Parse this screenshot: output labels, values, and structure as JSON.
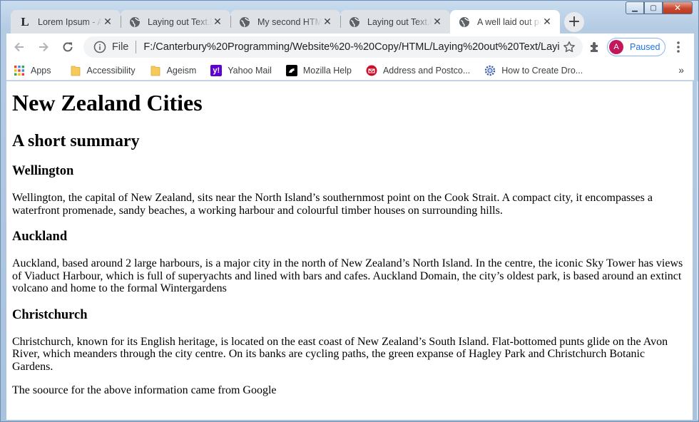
{
  "window": {
    "controls": {
      "minimize": "▁",
      "maximize": "▢",
      "close": "✕"
    }
  },
  "tabs": [
    {
      "title": "Lorem Ipsum - All the facts",
      "favicon": "L",
      "icon": "letter-l-icon",
      "active": false
    },
    {
      "title": "Laying out Text.html",
      "icon": "globe-icon",
      "active": false
    },
    {
      "title": "My second HTML page",
      "icon": "globe-icon",
      "active": false
    },
    {
      "title": "Laying out Text.html",
      "icon": "globe-icon",
      "active": false
    },
    {
      "title": "A well laid out page",
      "icon": "globe-icon",
      "active": true
    }
  ],
  "new_tab": "+",
  "toolbar": {
    "scheme": "File",
    "url": "F:/Canterbury%20Programming/Website%20-%20Copy/HTML/Laying%20out%20Text/Layin...",
    "profile_initial": "A",
    "profile_status": "Paused"
  },
  "bookmarks": [
    {
      "label": "Apps",
      "icon": "apps-grid-icon"
    },
    {
      "label": "Accessibility",
      "icon": "folder-icon"
    },
    {
      "label": "Ageism",
      "icon": "folder-icon"
    },
    {
      "label": "Yahoo Mail",
      "icon": "yahoo-icon"
    },
    {
      "label": "Mozilla Help",
      "icon": "mozilla-icon"
    },
    {
      "label": "Address and Postco...",
      "icon": "nz-post-icon"
    },
    {
      "label": "How to Create Dro...",
      "icon": "gear-icon"
    }
  ],
  "bookmarks_more": "»",
  "colors": {
    "accent": "#1a73e8",
    "avatar": "#c2185b",
    "folder": "#f6c95b"
  },
  "page": {
    "h1": "New Zealand Cities",
    "h2": "A short summary",
    "sections": [
      {
        "heading": "Wellington",
        "text": "Wellington, the capital of New Zealand, sits near the North Island’s southernmost point on the Cook Strait. A compact city, it encompasses a waterfront promenade, sandy beaches, a working harbour and colourful timber houses on surrounding hills."
      },
      {
        "heading": "Auckland",
        "text": "Auckland, based around 2 large harbours, is a major city in the north of New Zealand’s North Island. In the centre, the iconic Sky Tower has views of Viaduct Harbour, which is full of superyachts and lined with bars and cafes. Auckland Domain, the city’s oldest park, is based around an extinct volcano and home to the formal Wintergardens"
      },
      {
        "heading": "Christchurch",
        "text": "Christchurch, known for its English heritage, is located on the east coast of New Zealand’s South Island. Flat-bottomed punts glide on the Avon River, which meanders through the city centre. On its banks are cycling paths, the green expanse of Hagley Park and Christchurch Botanic Gardens."
      }
    ],
    "source": "The soource for the above information came from Google"
  }
}
